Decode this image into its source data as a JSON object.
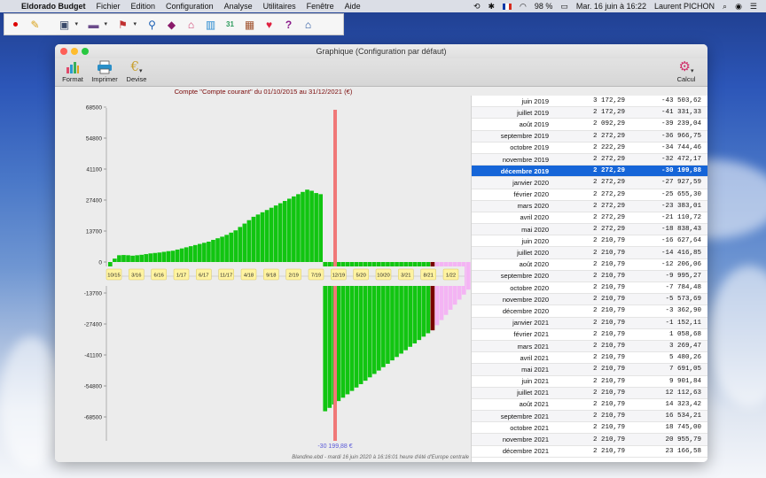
{
  "menubar": {
    "app": "Eldorado Budget",
    "menus": [
      "Fichier",
      "Edition",
      "Configuration",
      "Analyse",
      "Utilitaires",
      "Fenêtre",
      "Aide"
    ],
    "battery": "98 %",
    "datetime": "Mar. 16 juin à 16:22",
    "user": "Laurent PICHON"
  },
  "window": {
    "title": "Graphique (Configuration par défaut)",
    "tools": [
      {
        "label": "Format",
        "icon": "format-chart-icon"
      },
      {
        "label": "Imprimer",
        "icon": "printer-icon"
      },
      {
        "label": "Devise",
        "icon": "currency-icon"
      }
    ],
    "calcul_label": "Calcul"
  },
  "chart_data": {
    "type": "bar",
    "title": "Compte \"Compte courant\" du 01/10/2015 au 31/12/2021 (€)",
    "y_ticks": [
      68500,
      54800,
      41100,
      27400,
      13700,
      0,
      -13700,
      -27400,
      -41100,
      -54800,
      -68500
    ],
    "ylim": [
      -68500,
      68500
    ],
    "x_tick_labels": [
      "10/15",
      "3/16",
      "6/16",
      "1/17",
      "6/17",
      "11/17",
      "4/18",
      "9/18",
      "2/19",
      "7/19",
      "12/19",
      "5/20",
      "10/20",
      "3/21",
      "8/21",
      "1/22"
    ],
    "cursor_value_label": "-30 199,88 €",
    "footer": "Blandine.ebd - mardi 16 juin 2020 à 16:16:01 heure d'été d'Europe centrale",
    "positive_values": [
      -2000,
      1500,
      3000,
      3100,
      3000,
      2800,
      3000,
      3200,
      3500,
      3800,
      4000,
      4200,
      4500,
      4800,
      5000,
      5500,
      6000,
      6500,
      7000,
      7500,
      8000,
      8500,
      9000,
      9800,
      10500,
      11200,
      12000,
      13000,
      14000,
      15500,
      17000,
      18500,
      20000,
      21000,
      22000,
      23000,
      24000,
      25000,
      26000,
      27000,
      28000,
      29000,
      30000,
      31000,
      32000,
      31500,
      30500,
      30000
    ],
    "negative_values": [
      -66000,
      -64500,
      -63000,
      -61500,
      -60000,
      -58500,
      -57000,
      -55500,
      -54000,
      -52500,
      -51000,
      -49500,
      -48000,
      -46500,
      -45000,
      -43500,
      -42000,
      -40500,
      -39000,
      -37500,
      -36000,
      -34500,
      -33000,
      -31500,
      -30199.88,
      -27928,
      -25655,
      -23383,
      -21111,
      -18838,
      -16628,
      -14417,
      -12206,
      -9995,
      -7785,
      -5574,
      -3363
    ],
    "future_values": [
      -1152,
      1059,
      3269,
      5480,
      7691,
      9902,
      12113,
      14323,
      16534,
      18745,
      20956,
      23167
    ],
    "colors": {
      "history": "#11c511",
      "current": "#7a0000",
      "future": "#f4b4f4",
      "cursor": "#f07878"
    }
  },
  "table": {
    "rows": [
      {
        "month": "juin 2019",
        "amount": "3 172,29",
        "balance": "-43 503,62"
      },
      {
        "month": "juillet 2019",
        "amount": "2 172,29",
        "balance": "-41 331,33"
      },
      {
        "month": "août 2019",
        "amount": "2 092,29",
        "balance": "-39 239,04"
      },
      {
        "month": "septembre 2019",
        "amount": "2 272,29",
        "balance": "-36 966,75"
      },
      {
        "month": "octobre 2019",
        "amount": "2 222,29",
        "balance": "-34 744,46"
      },
      {
        "month": "novembre 2019",
        "amount": "2 272,29",
        "balance": "-32 472,17"
      },
      {
        "month": "décembre 2019",
        "amount": "2 272,29",
        "balance": "-30 199,88"
      },
      {
        "month": "janvier 2020",
        "amount": "2 272,29",
        "balance": "-27 927,59"
      },
      {
        "month": "février 2020",
        "amount": "2 272,29",
        "balance": "-25 655,30"
      },
      {
        "month": "mars 2020",
        "amount": "2 272,29",
        "balance": "-23 383,01"
      },
      {
        "month": "avril 2020",
        "amount": "2 272,29",
        "balance": "-21 110,72"
      },
      {
        "month": "mai 2020",
        "amount": "2 272,29",
        "balance": "-18 838,43"
      },
      {
        "month": "juin 2020",
        "amount": "2 210,79",
        "balance": "-16 627,64"
      },
      {
        "month": "juillet 2020",
        "amount": "2 210,79",
        "balance": "-14 416,85"
      },
      {
        "month": "août 2020",
        "amount": "2 210,79",
        "balance": "-12 206,06"
      },
      {
        "month": "septembre 2020",
        "amount": "2 210,79",
        "balance": "-9 995,27"
      },
      {
        "month": "octobre 2020",
        "amount": "2 210,79",
        "balance": "-7 784,48"
      },
      {
        "month": "novembre 2020",
        "amount": "2 210,79",
        "balance": "-5 573,69"
      },
      {
        "month": "décembre 2020",
        "amount": "2 210,79",
        "balance": "-3 362,90"
      },
      {
        "month": "janvier 2021",
        "amount": "2 210,79",
        "balance": "-1 152,11"
      },
      {
        "month": "février 2021",
        "amount": "2 210,79",
        "balance": "1 058,68"
      },
      {
        "month": "mars 2021",
        "amount": "2 210,79",
        "balance": "3 269,47"
      },
      {
        "month": "avril 2021",
        "amount": "2 210,79",
        "balance": "5 480,26"
      },
      {
        "month": "mai 2021",
        "amount": "2 210,79",
        "balance": "7 691,05"
      },
      {
        "month": "juin 2021",
        "amount": "2 210,79",
        "balance": "9 901,84"
      },
      {
        "month": "juillet 2021",
        "amount": "2 210,79",
        "balance": "12 112,63"
      },
      {
        "month": "août 2021",
        "amount": "2 210,79",
        "balance": "14 323,42"
      },
      {
        "month": "septembre 2021",
        "amount": "2 210,79",
        "balance": "16 534,21"
      },
      {
        "month": "octobre 2021",
        "amount": "2 210,79",
        "balance": "18 745,00"
      },
      {
        "month": "novembre 2021",
        "amount": "2 210,79",
        "balance": "20 955,79"
      },
      {
        "month": "décembre 2021",
        "amount": "2 210,79",
        "balance": "23 166,58"
      }
    ],
    "selected_month": "décembre 2019"
  }
}
